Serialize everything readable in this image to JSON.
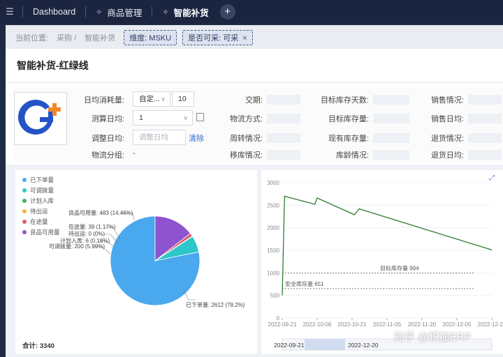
{
  "topbar": {
    "tabs": [
      {
        "label": "Dashboard",
        "active": false,
        "pinned": false
      },
      {
        "label": "商品管理",
        "active": false,
        "pinned": true
      },
      {
        "label": "智能补货",
        "active": true,
        "pinned": true
      }
    ],
    "add_label": "+"
  },
  "breadcrumb": {
    "current_location": "当前位置",
    "path": [
      "采购",
      "智能补货"
    ],
    "filters": [
      {
        "text": "维度: MSKU",
        "closable": false
      },
      {
        "text": "是否可采: 可采",
        "closable": true
      }
    ]
  },
  "dialog": {
    "title": "智能补货-红绿线",
    "form": {
      "daily_consumption": {
        "label": "日均消耗量:",
        "mode": "自定...",
        "value": "10"
      },
      "calc_daily": {
        "label": "测算日均:",
        "value": "1"
      },
      "adjust_daily": {
        "label": "调整日均:",
        "placeholder": "调整日均",
        "clear_label": "清除"
      },
      "logistics_group": {
        "label": "物流分组:",
        "value": "-"
      },
      "info_labels": [
        [
          "交期:",
          "物流方式:",
          "周转情况:",
          "移库情况:"
        ],
        [
          "目标库存天数:",
          "目标库存量:",
          "现有库存量:",
          "库龄情况:"
        ],
        [
          "销售情况:",
          "销售日均:",
          "退货情况:",
          "退货日均:"
        ]
      ]
    }
  },
  "pie_chart": {
    "legend": [
      "已下单量",
      "可调拨量",
      "计划入库",
      "待出运",
      "在途量",
      "良品可用量"
    ],
    "slice_labels": [
      "良品可用量: 483 (14.46%)",
      "在途量: 39 (1.17%)",
      "待出运: 0 (0%)",
      "计划入库: 6 (0.18%)",
      "可调拨量: 200 (5.99%)",
      "已下单量: 2612 (78.2%)"
    ],
    "total_label": "合计:",
    "total_value": "3340"
  },
  "line_chart": {
    "x_tick_labels": [
      "2022-09-21",
      "2022-10-06",
      "2022-10-21",
      "2022-11-05",
      "2022-11-20",
      "2022-12-05",
      "2022-12-20"
    ],
    "y_tick_labels": [
      "0",
      "500",
      "1000",
      "1500",
      "2000",
      "2500",
      "3000"
    ],
    "target_label": "目标库存量 994",
    "safety_label": "安全库存量 651",
    "zoom_start": "2022-09-21",
    "zoom_end": "2022-12-20"
  },
  "chart_data": [
    {
      "type": "pie",
      "categories": [
        "已下单量",
        "可调拨量",
        "计划入库",
        "待出运",
        "在途量",
        "良品可用量"
      ],
      "values": [
        2612,
        200,
        6,
        0,
        39,
        483
      ],
      "colors": [
        "#4aa8ee",
        "#2ec7c9",
        "#3bb36a",
        "#f5b82e",
        "#e05a6b",
        "#8e54cf"
      ]
    },
    {
      "type": "line",
      "x": [
        "2022-09-21",
        "2022-09-22",
        "2022-10-05",
        "2022-10-06",
        "2022-10-22",
        "2022-10-24",
        "2022-12-20"
      ],
      "series": [
        {
          "values": [
            500,
            2700,
            2520,
            2660,
            2290,
            2420,
            1510
          ]
        }
      ],
      "ylim": [
        0,
        3000
      ],
      "target_stock": 994,
      "safety_stock": 651,
      "line_color": "#2f7d32"
    }
  ],
  "watermark": "知乎 @积加ERP"
}
